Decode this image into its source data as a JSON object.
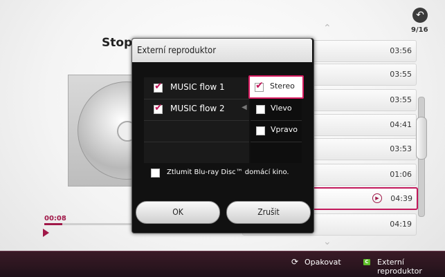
{
  "header": {
    "page_counter": "9/16"
  },
  "background": {
    "title": "Stopa"
  },
  "player": {
    "elapsed": "00:08"
  },
  "tracks": [
    {
      "duration": "03:56"
    },
    {
      "duration": "03:55"
    },
    {
      "duration": "03:55"
    },
    {
      "duration": "04:41"
    },
    {
      "duration": "03:53"
    },
    {
      "duration": "01:06"
    },
    {
      "duration": "04:39",
      "selected": true
    },
    {
      "duration": "04:19"
    }
  ],
  "dialog": {
    "title": "Externí reproduktor",
    "devices": [
      {
        "label": "MUSIC flow 1",
        "checked": true
      },
      {
        "label": "MUSIC flow 2",
        "checked": true
      }
    ],
    "channels": [
      {
        "label": "Stereo",
        "checked": true,
        "focused": true
      },
      {
        "label": "Vlevo",
        "checked": false
      },
      {
        "label": "Vpravo",
        "checked": false
      }
    ],
    "mute": {
      "label": "Ztlumit Blu-ray Disc™ domácí kino.",
      "checked": false
    },
    "ok_label": "OK",
    "cancel_label": "Zrušit"
  },
  "footer": {
    "repeat_label": "Opakovat",
    "green_key": "C",
    "speaker_label": "Externí reproduktor"
  },
  "colors": {
    "accent": "#c2185b",
    "footer_bg": "#2a1620",
    "green_key": "#5fbf2a"
  }
}
